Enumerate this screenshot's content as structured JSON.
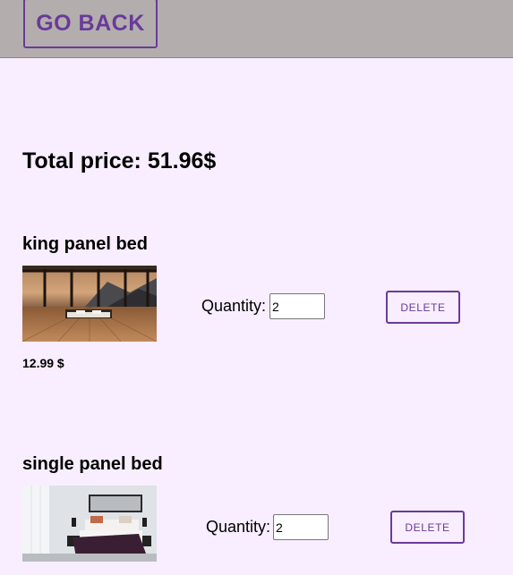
{
  "header": {
    "go_back_label": "GO BACK"
  },
  "cart": {
    "total_label": "Total price: 51.96$",
    "items": [
      {
        "name": "king panel bed",
        "quantity_label": "Quantity:",
        "quantity_value": "2",
        "delete_label": "DELETE",
        "price": "12.99 $"
      },
      {
        "name": "single panel bed",
        "quantity_label": "Quantity:",
        "quantity_value": "2",
        "delete_label": "DELETE"
      }
    ]
  },
  "colors": {
    "accent": "#6a3a9a",
    "header_bg": "#b3aead",
    "page_bg": "#f8eeff"
  }
}
